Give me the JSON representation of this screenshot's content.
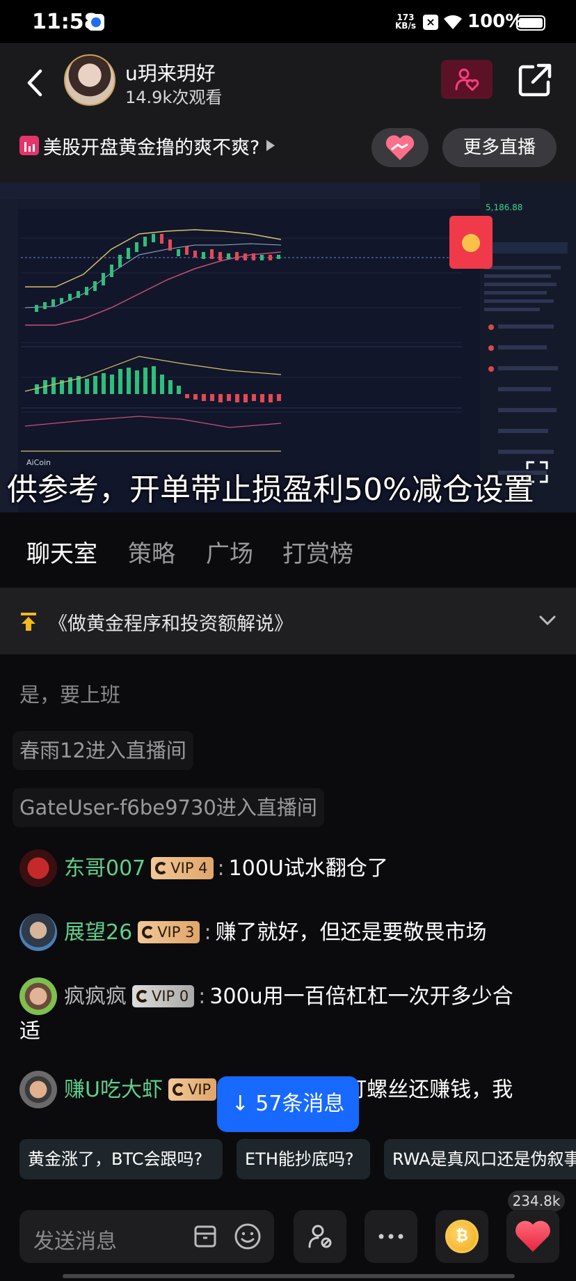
{
  "status": {
    "time": "11:58",
    "speed_value": "173",
    "speed_unit": "KB/s",
    "battery": "100%"
  },
  "header": {
    "host_name": "u玥来玥好",
    "view_count": "14.9k次观看",
    "topic": "美股开盘黄金撸的爽不爽?",
    "more_live": "更多直播"
  },
  "video": {
    "subtitle": "供参考，开单带止损盈利50%减仓设置",
    "chart_price": "5,186.88",
    "chart_brand": "AiCoin"
  },
  "tabs": [
    {
      "label": "聊天室",
      "active": true
    },
    {
      "label": "策略",
      "active": false
    },
    {
      "label": "广场",
      "active": false
    },
    {
      "label": "打赏榜",
      "active": false
    }
  ],
  "pinned": {
    "text": "《做黄金程序和投资额解说》"
  },
  "chat": {
    "system": [
      "是，要上班",
      "春雨12进入直播间",
      "GateUser-f6be9730进入直播间"
    ],
    "messages": [
      {
        "name": "东哥007",
        "vip": "VIP 4",
        "text": "100U试水翻仓了"
      },
      {
        "name": "展望26",
        "vip": "VIP 3",
        "text": "赚了就好，但还是要敬畏市场"
      },
      {
        "name": "疯疯疯",
        "vip": "VIP 0",
        "text": "300u用一百倍杠杠一次开多少合",
        "text2": "适"
      },
      {
        "name": "赚U吃大虾",
        "vip": "VIP",
        "text": "我打螺丝还赚钱，我"
      }
    ]
  },
  "new_messages": "↓ 57条消息",
  "quick_replies": [
    "黄金涨了，BTC会跟吗?",
    "ETH能抄底吗?",
    "RWA是真风口还是伪叙事"
  ],
  "likes": "234.8k",
  "input": {
    "placeholder": "发送消息"
  },
  "colors": {
    "accent_blue": "#1769ff",
    "vip_gold": "#dfa56a",
    "username_green": "#5fcf8c",
    "like_red": "#f0445a"
  }
}
